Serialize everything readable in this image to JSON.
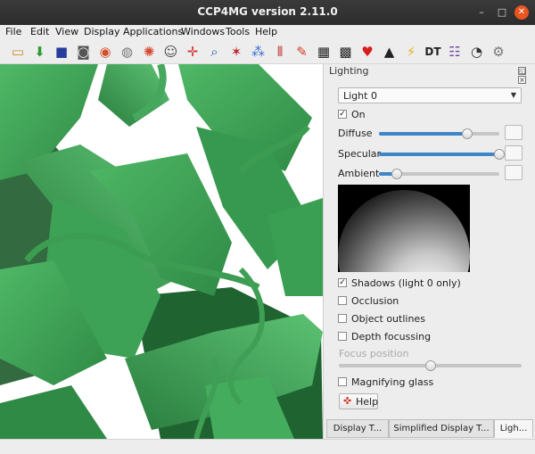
{
  "window": {
    "title": "CCP4MG version 2.11.0",
    "controls": {
      "minimize": "–",
      "maximize": "□",
      "close": "✕"
    }
  },
  "menu": [
    "File",
    "Edit",
    "View",
    "Display",
    "Applications",
    "Windows",
    "Tools",
    "Help"
  ],
  "toolbar": {
    "tools": [
      {
        "name": "open-folder-icon",
        "glyph": "▭",
        "color": "#c98b2a"
      },
      {
        "name": "download-icon",
        "glyph": "⬇",
        "color": "#2f9a2f"
      },
      {
        "name": "save-icon",
        "glyph": "■",
        "color": "#263c9c"
      },
      {
        "name": "camera-icon",
        "glyph": "◙",
        "color": "#555555"
      },
      {
        "name": "rotate-icon",
        "glyph": "◉",
        "color": "#d2502a"
      },
      {
        "name": "rotate-alt-icon",
        "glyph": "◍",
        "color": "#777777"
      },
      {
        "name": "color-wheel-icon",
        "glyph": "✺",
        "color": "#d8472f"
      },
      {
        "name": "head-icon",
        "glyph": "☺",
        "color": "#444444"
      },
      {
        "name": "center-icon",
        "glyph": "✛",
        "color": "#d22a2a"
      },
      {
        "name": "zoom-icon",
        "glyph": "⌕",
        "color": "#2a5fa8"
      },
      {
        "name": "measure-icon",
        "glyph": "✶",
        "color": "#c02a2a"
      },
      {
        "name": "molecule-icon",
        "glyph": "⁂",
        "color": "#3a6fd0"
      },
      {
        "name": "dna-icon",
        "glyph": "⦀",
        "color": "#c02a2a"
      },
      {
        "name": "pen-icon",
        "glyph": "✎",
        "color": "#d23c2a"
      },
      {
        "name": "movie-icon",
        "glyph": "▦",
        "color": "#222222"
      },
      {
        "name": "movie-star-icon",
        "glyph": "▩",
        "color": "#222222"
      },
      {
        "name": "heart-icon",
        "glyph": "♥",
        "color": "#d81e1e"
      },
      {
        "name": "graduation-cap-icon",
        "glyph": "▲",
        "color": "#222222"
      },
      {
        "name": "wand-icon",
        "glyph": "⚡",
        "color": "#e0b21e"
      },
      {
        "name": "simple-dt-icon",
        "glyph": "DT",
        "color": "#222222"
      },
      {
        "name": "display-mode-icon",
        "glyph": "☷",
        "color": "#7a4aa8"
      },
      {
        "name": "eye-pdb-icon",
        "glyph": "◔",
        "color": "#333333"
      },
      {
        "name": "settings-icon",
        "glyph": "⚙",
        "color": "#777777"
      }
    ]
  },
  "panel": {
    "title": "Lighting",
    "light_select": "Light 0",
    "on_label": "On",
    "on_checked": true,
    "diffuse": {
      "label": "Diffuse",
      "value": 0.73
    },
    "specular": {
      "label": "Specular",
      "value": 1.0
    },
    "ambient": {
      "label": "Ambient",
      "value": 0.15
    },
    "options": [
      {
        "label": "Shadows (light 0 only)",
        "checked": true
      },
      {
        "label": "Occlusion",
        "checked": false
      },
      {
        "label": "Object outlines",
        "checked": false
      },
      {
        "label": "Depth focussing",
        "checked": false
      }
    ],
    "focus_position": {
      "label": "Focus position",
      "value": 0.5
    },
    "magnifying": {
      "label": "Magnifying glass",
      "checked": false
    },
    "help_label": "Help"
  },
  "tabs": [
    {
      "label": "Display T...",
      "active": false
    },
    {
      "label": "Simplified Display T...",
      "active": false
    },
    {
      "label": "Ligh...",
      "active": true
    }
  ]
}
